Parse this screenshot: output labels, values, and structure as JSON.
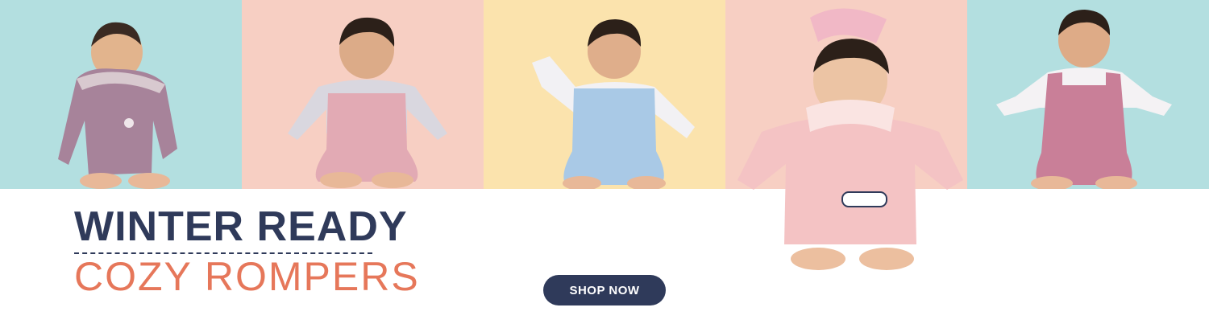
{
  "banner": {
    "headline": "WINTER READY",
    "subheadline": "COZY ROMPERS",
    "cta_label": "SHOP NOW"
  },
  "colors": {
    "navy": "#2f3a5a",
    "coral": "#e6775a",
    "mint": "#b3dfe0",
    "peach": "#f7cfc3",
    "butter": "#fbe3ad"
  },
  "photos": [
    "baby-in-purple-hooded-romper",
    "baby-in-pink-dungaree-romper",
    "baby-in-blue-dinosaur-romper",
    "baby-girl-in-pink-hoodie-romper",
    "baby-in-mauve-bunny-romper"
  ]
}
